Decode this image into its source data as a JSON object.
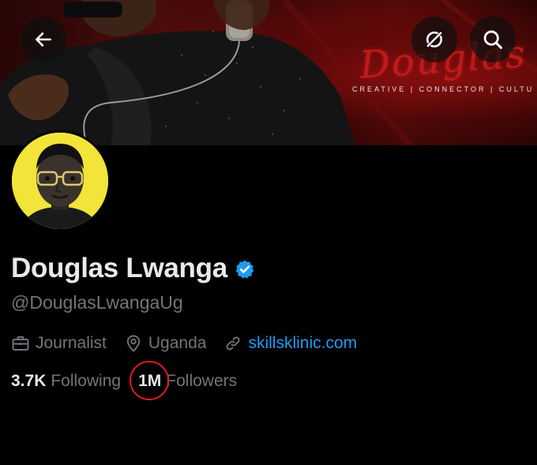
{
  "banner": {
    "script_text": "Douglas Lwanga",
    "tagline": "CREATIVE | CONNECTOR | CULTU",
    "accent_color": "#c91c1c"
  },
  "header_buttons": {
    "back": {
      "icon": "arrow-left-icon"
    },
    "grok": {
      "icon": "grok-icon"
    },
    "search": {
      "icon": "search-icon"
    }
  },
  "profile": {
    "display_name": "Douglas Lwanga",
    "verified": true,
    "verified_color": "#1d9bf0",
    "handle": "@DouglasLwangaUg",
    "profession": "Journalist",
    "location": "Uganda",
    "website": "skillsklinic.com"
  },
  "stats": {
    "following_count": "3.7K",
    "following_label": "Following",
    "followers_count": "1M",
    "followers_label": "Followers",
    "highlight_color": "#e11b22"
  },
  "colors": {
    "background": "#000000",
    "primary_text": "#e7e9ea",
    "secondary_text": "#71767b",
    "link": "#1d9bf0"
  }
}
